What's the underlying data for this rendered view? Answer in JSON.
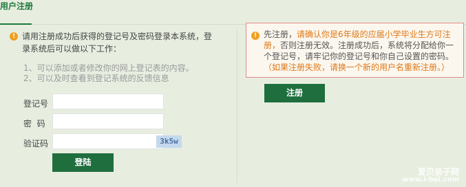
{
  "header": {
    "tab_label": "用户注册"
  },
  "login_notice": {
    "text": "请用注册成功后获得的登记号及密码登录本系统，登录系统后可以做以下工作："
  },
  "features": [
    "1、可以添加或者修改你的网上登记表的内容。",
    "2、可以及时查看到登记系统的反馈信息"
  ],
  "login_form": {
    "reg_number_label": "登记号",
    "reg_number_value": "",
    "password_label": "密  码",
    "password_value": "",
    "captcha_label": "验证码",
    "captcha_value": "",
    "captcha_code": "3k5w",
    "submit_label": "登陆"
  },
  "register_notice": {
    "text_part1": "先注册，",
    "text_highlight1": "请确认你是6年级的应届小学毕业生方可注册，",
    "text_part2": "否则注册无效。注册成功后，系统将分配给你一个登记号，请牢记你的登记号和你自己设置的密码。",
    "text_highlight2": "（如果注册失败，请换一个新的用户名重新注册。）"
  },
  "register_button": {
    "label": "注册"
  },
  "watermark": {
    "line1": "爱贝亲子网",
    "line2": "www.i-bei.com"
  },
  "colors": {
    "background": "#e7eee0",
    "accent_green": "#1f6e3e",
    "warning_orange": "#e07818",
    "alert_border": "#e08a8a"
  }
}
